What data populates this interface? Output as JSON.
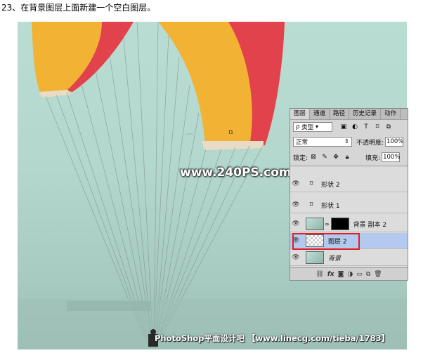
{
  "caption": "23、在背景图层上面新建一个空白图层。",
  "watermark": "www.240PS.com",
  "footer": "PhotoShop平面设计吧 【www.linecg.com/tieba/1783】",
  "panel": {
    "tabs": [
      "图层",
      "通道",
      "路径",
      "历史记录",
      "动作"
    ],
    "kind_label": "类型",
    "blend_mode": "正常",
    "opacity_label": "不透明度:",
    "opacity_value": "100%",
    "lock_label": "锁定:",
    "fill_label": "填充:",
    "fill_value": "100%",
    "layers": [
      {
        "name": "形状 2",
        "type": "shape"
      },
      {
        "name": "形状 1",
        "type": "shape"
      },
      {
        "name": "背景 副本 2",
        "type": "masked"
      },
      {
        "name": "图层 2",
        "type": "empty",
        "selected": true
      },
      {
        "name": "背景",
        "type": "background"
      }
    ],
    "bottom_icons": [
      "link-icon",
      "fx-icon",
      "mask-icon",
      "adjustment-icon",
      "folder-icon",
      "new-layer-icon",
      "trash-icon"
    ]
  },
  "colors": {
    "selected_row": "#b4c9ee",
    "highlight_box": "#e02020",
    "canopy_orange": "#f2b233",
    "canopy_red": "#e2424b"
  }
}
